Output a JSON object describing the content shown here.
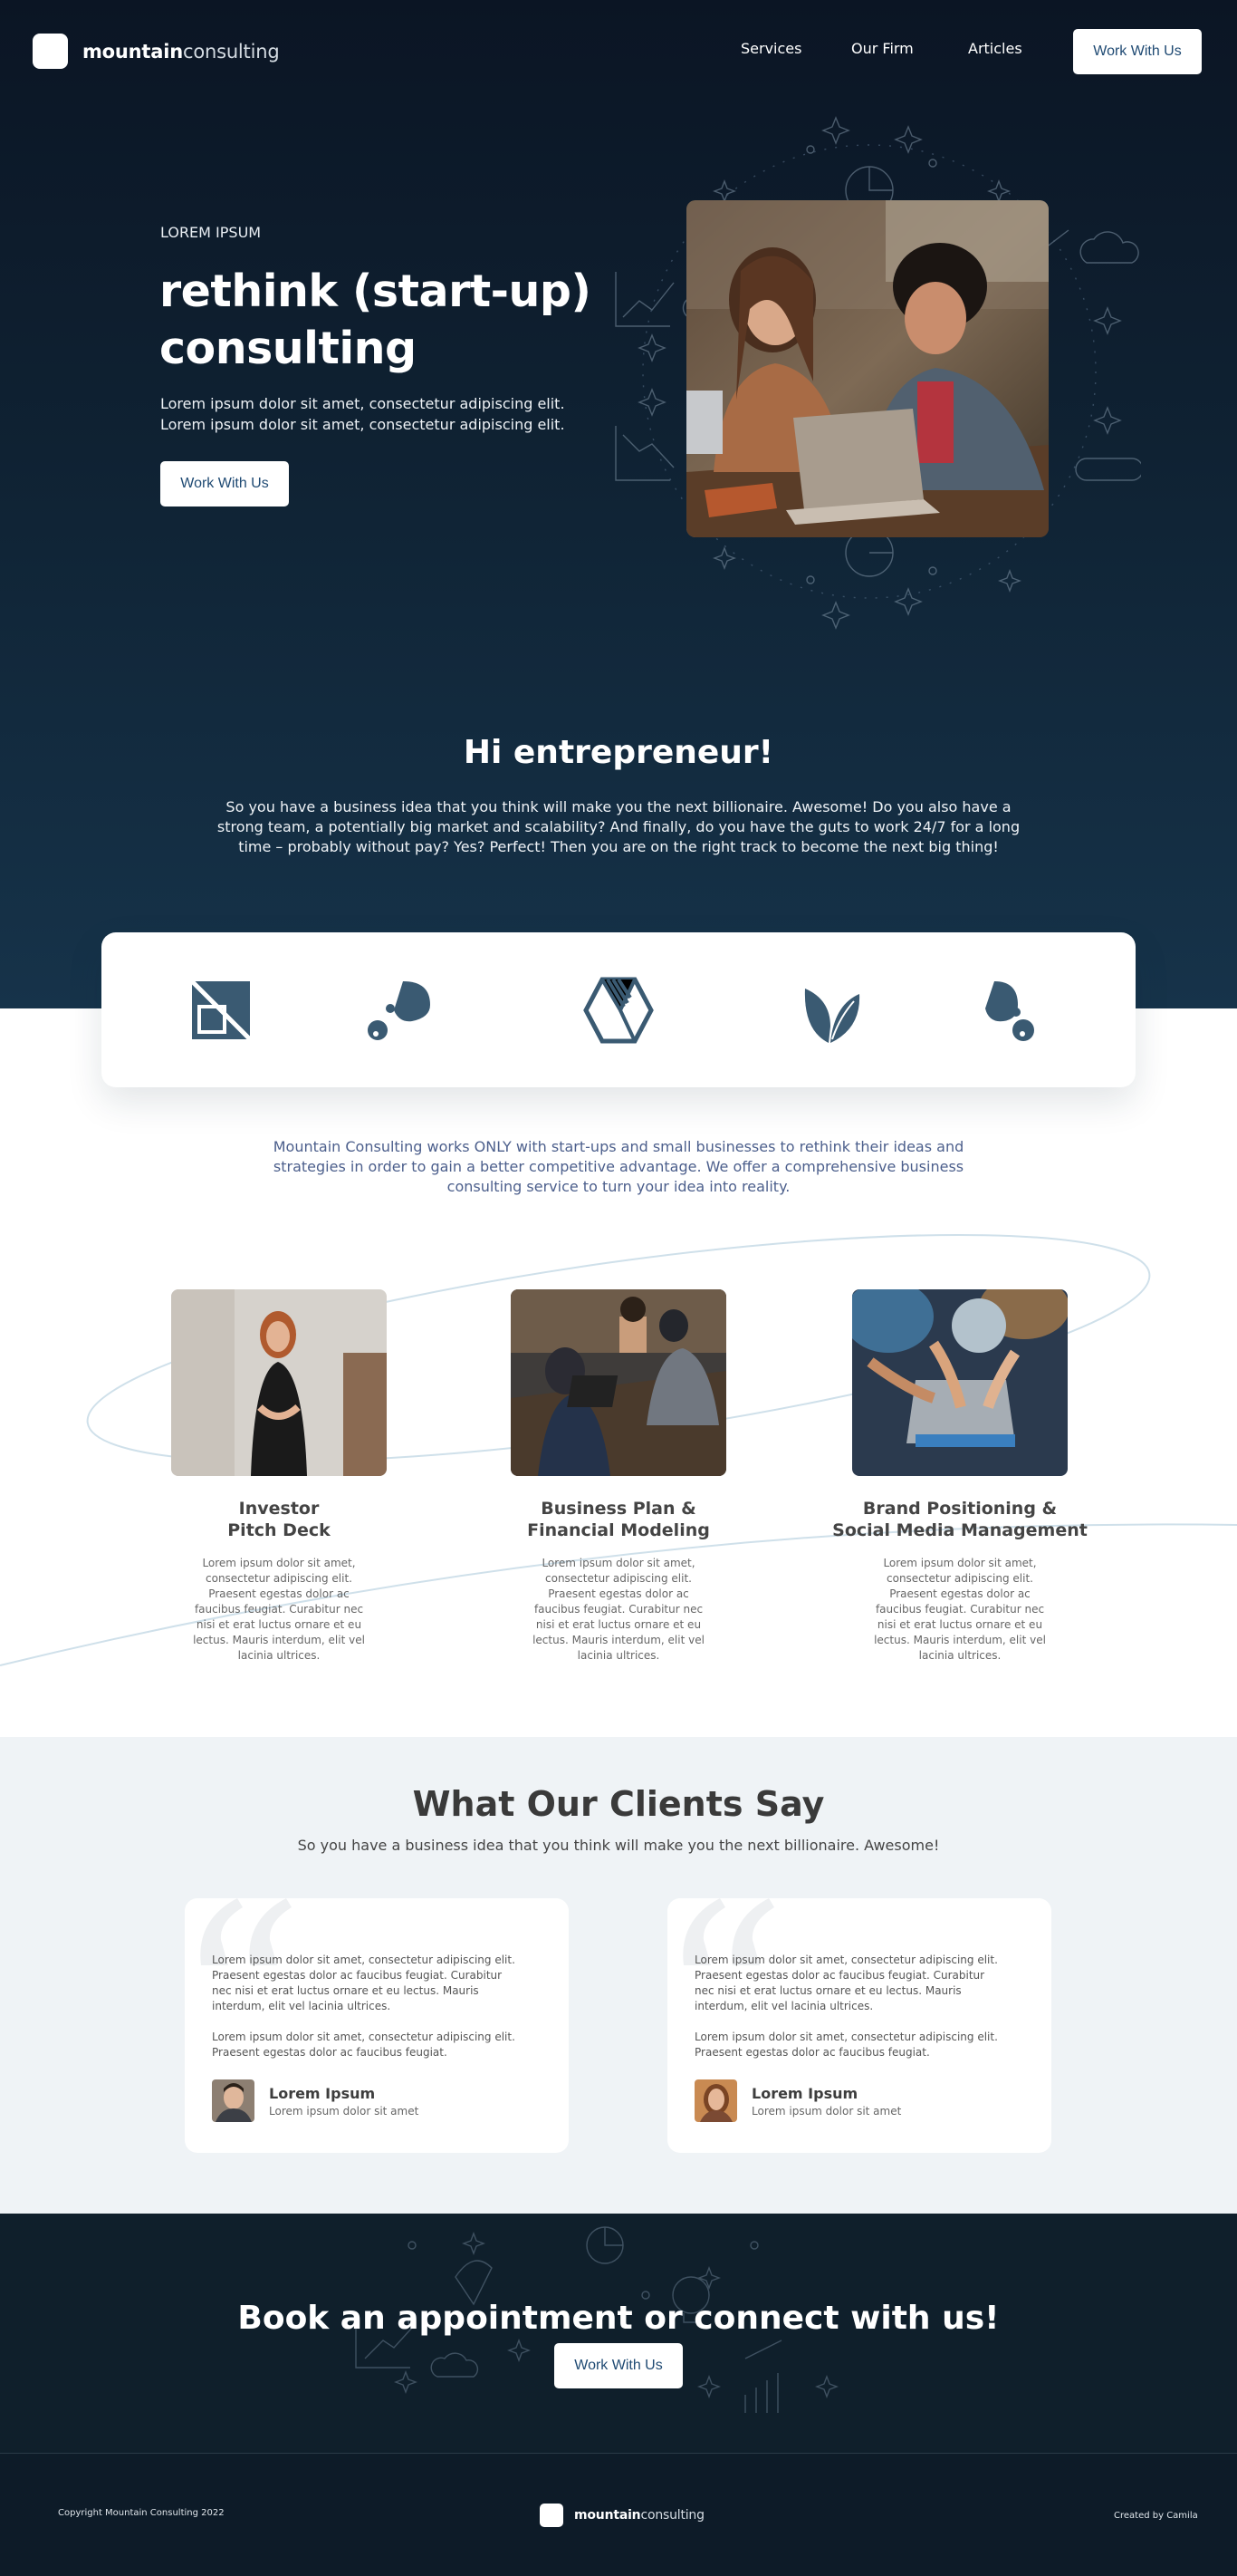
{
  "nav": {
    "logo_bold": "mountain",
    "logo_light": "consulting",
    "links": [
      "Services",
      "Our Firm",
      "Articles"
    ],
    "cta": "Work With Us"
  },
  "hero": {
    "kicker": "LOREM IPSUM",
    "title": "rethink (start-up) consulting",
    "description": "Lorem ipsum dolor sit amet, consectetur adipiscing elit. Lorem ipsum dolor sit amet, consectetur adipiscing elit.",
    "cta": "Work With Us"
  },
  "intro_block": {
    "title": "Hi entrepreneur!",
    "text": "So you have a business idea that you think will make you the next billionaire. Awesome! Do you also have a strong team, a potentially big market and scalability? And finally, do you have the guts to work 24/7 for a long time – probably without pay? Yes? Perfect! Then you are on the right track to become the next big thing!"
  },
  "icons": {
    "names": [
      "square-shape-icon",
      "drops-icon",
      "hexagon-icon",
      "leaf-icon",
      "drop-dot-icon"
    ],
    "color": "#3a5a72"
  },
  "services": {
    "intro": "Mountain Consulting works ONLY with start-ups and small businesses to rethink their ideas and strategies in order to gain a better competitive advantage. We offer a comprehensive business consulting service to turn your idea into reality.",
    "items": [
      {
        "title_line1": "Investor",
        "title_line2": "Pitch Deck",
        "text": "Lorem ipsum dolor sit amet, consectetur adipiscing elit. Praesent egestas dolor ac faucibus feugiat. Curabitur nec nisi et erat luctus ornare et eu lectus. Mauris interdum, elit vel lacinia ultrices."
      },
      {
        "title_line1": "Business Plan &",
        "title_line2": "Financial Modeling",
        "text": "Lorem ipsum dolor sit amet, consectetur adipiscing elit. Praesent egestas dolor ac faucibus feugiat. Curabitur nec nisi et erat luctus ornare et eu lectus. Mauris interdum, elit vel lacinia ultrices."
      },
      {
        "title_line1": "Brand Positioning &",
        "title_line2": "Social Media Management",
        "text": "Lorem ipsum dolor sit amet, consectetur adipiscing elit. Praesent egestas dolor ac faucibus feugiat. Curabitur nec nisi et erat luctus ornare et eu lectus. Mauris interdum, elit vel lacinia ultrices."
      }
    ]
  },
  "testimonials": {
    "title": "What Our Clients Say",
    "subtitle": "So you have a business idea that you think will make you the next billionaire. Awesome!",
    "cards": [
      {
        "p1": "Lorem ipsum dolor sit amet, consectetur adipiscing elit. Praesent egestas dolor ac faucibus feugiat. Curabitur nec nisi et erat luctus ornare et eu lectus. Mauris interdum, elit vel lacinia ultrices.",
        "p2": "Lorem ipsum dolor sit amet, consectetur adipiscing elit. Praesent egestas dolor ac faucibus feugiat.",
        "name": "Lorem Ipsum",
        "role": "Lorem ipsum dolor sit amet"
      },
      {
        "p1": "Lorem ipsum dolor sit amet, consectetur adipiscing elit. Praesent egestas dolor ac faucibus feugiat. Curabitur nec nisi et erat luctus ornare et eu lectus. Mauris interdum, elit vel lacinia ultrices.",
        "p2": "Lorem ipsum dolor sit amet, consectetur adipiscing elit. Praesent egestas dolor ac faucibus feugiat.",
        "name": "Lorem Ipsum",
        "role": "Lorem ipsum dolor sit amet"
      }
    ]
  },
  "cta": {
    "title": "Book an appointment or connect with us!",
    "button": "Work With Us"
  },
  "footer": {
    "copyright": "Copyright Mountain Consulting 2022",
    "logo_bold": "mountain",
    "logo_light": "consulting",
    "credit": "Created by Camila"
  },
  "colors": {
    "hero_dark": "#0b1524",
    "hero_mid": "#16334a",
    "accent_blue": "#1f4a73",
    "icon_slate": "#3a5a72",
    "testimonial_bg": "#eff3f6",
    "footer_bg": "#0d1b28"
  }
}
